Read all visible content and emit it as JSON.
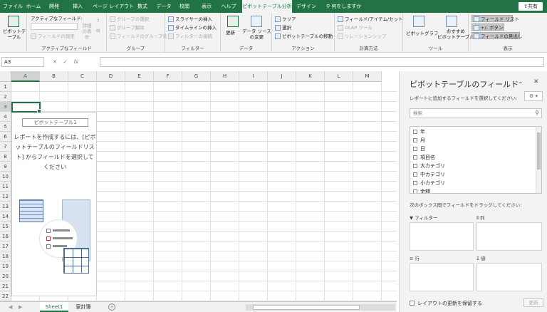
{
  "colors": {
    "accent": "#217346",
    "ribbon_bg": "#f3f3f3",
    "pane_bg": "#f3f3f3"
  },
  "tabs": [
    "ファイル",
    "ホーム",
    "開発",
    "挿入",
    "ページ レイアウト",
    "数式",
    "データ",
    "校閲",
    "表示",
    "ヘルプ",
    "ピボットテーブル分析",
    "デザイン"
  ],
  "tell_me": "何をしますか",
  "share_label": "共有",
  "ribbon": {
    "pivot_label": "ピボットテーブル",
    "active_field_title": "アクティブなフィールド:",
    "field_settings": "フィールドの設定",
    "drill_down": "詳細の表示",
    "groups_label_active_field": "アクティブなフィールド",
    "group_selection": "グループの選択",
    "ungroup": "グループ解除",
    "group_field": "フィールドのグループ化",
    "groups_label_group": "グループ",
    "insert_slicer": "スライサーの挿入",
    "insert_timeline": "タイムラインの挿入",
    "filter_connections": "フィルターの接続",
    "groups_label_filter": "フィルター",
    "refresh": "更新",
    "change_source_l1": "データ ソース",
    "change_source_l2": "の変更",
    "groups_label_data": "データ",
    "clear": "クリア",
    "select": "選択",
    "move_pivot": "ピボットテーブルの移動",
    "groups_label_action": "アクション",
    "fields_items": "フィールド/アイテム/セット",
    "olap_tools": "OLAP ツール",
    "relationships": "リレーションシップ",
    "groups_label_calc": "計算方法",
    "pivot_chart": "ピボットグラフ",
    "recommended_l1": "おすすめ",
    "recommended_l2": "ピボットテーブル",
    "groups_label_tools": "ツール",
    "field_list": "フィールド リスト",
    "buttons": "+/- ボタン",
    "field_headers": "フィールドの見出し",
    "groups_label_show": "表示"
  },
  "formula": {
    "name_box": "A3",
    "cancel": "✕",
    "enter": "✓",
    "fx": "fx",
    "value": ""
  },
  "sheet": {
    "columns": [
      "A",
      "B",
      "C",
      "D",
      "E",
      "F",
      "G",
      "H",
      "I",
      "J",
      "K",
      "L",
      "M"
    ],
    "rows": [
      "1",
      "2",
      "3",
      "4",
      "5",
      "6",
      "7",
      "8",
      "9",
      "10",
      "11",
      "12",
      "13",
      "14",
      "15",
      "16",
      "17",
      "18",
      "19",
      "20",
      "21",
      "22"
    ],
    "active_column": "A",
    "active_row": "3"
  },
  "pivot_placeholder": {
    "title": "ピボットテーブル1",
    "description": "レポートを作成するには、[ピボットテーブルのフィールドリスト] からフィールドを選択してください"
  },
  "sheet_tabs": [
    {
      "name": "Sheet1",
      "active": true
    },
    {
      "name": "家計簿",
      "active": false
    }
  ],
  "add_sheet": "+",
  "pane": {
    "title": "ピボットテーブルのフィールド",
    "subtitle": "レポートに追加するフィールドを選択してください:",
    "search_placeholder": "検索",
    "fields": [
      "年",
      "月",
      "日",
      "項目名",
      "大カテゴリ",
      "中カテゴリ",
      "小カテゴリ",
      "金額"
    ],
    "drag_note": "次のボックス間でフィールドをドラッグしてください:",
    "zones": {
      "filter": "フィルター",
      "columns": "列",
      "rows": "行",
      "values": "値"
    },
    "defer_label": "レイアウトの更新を保留する",
    "update_label": "更新"
  }
}
